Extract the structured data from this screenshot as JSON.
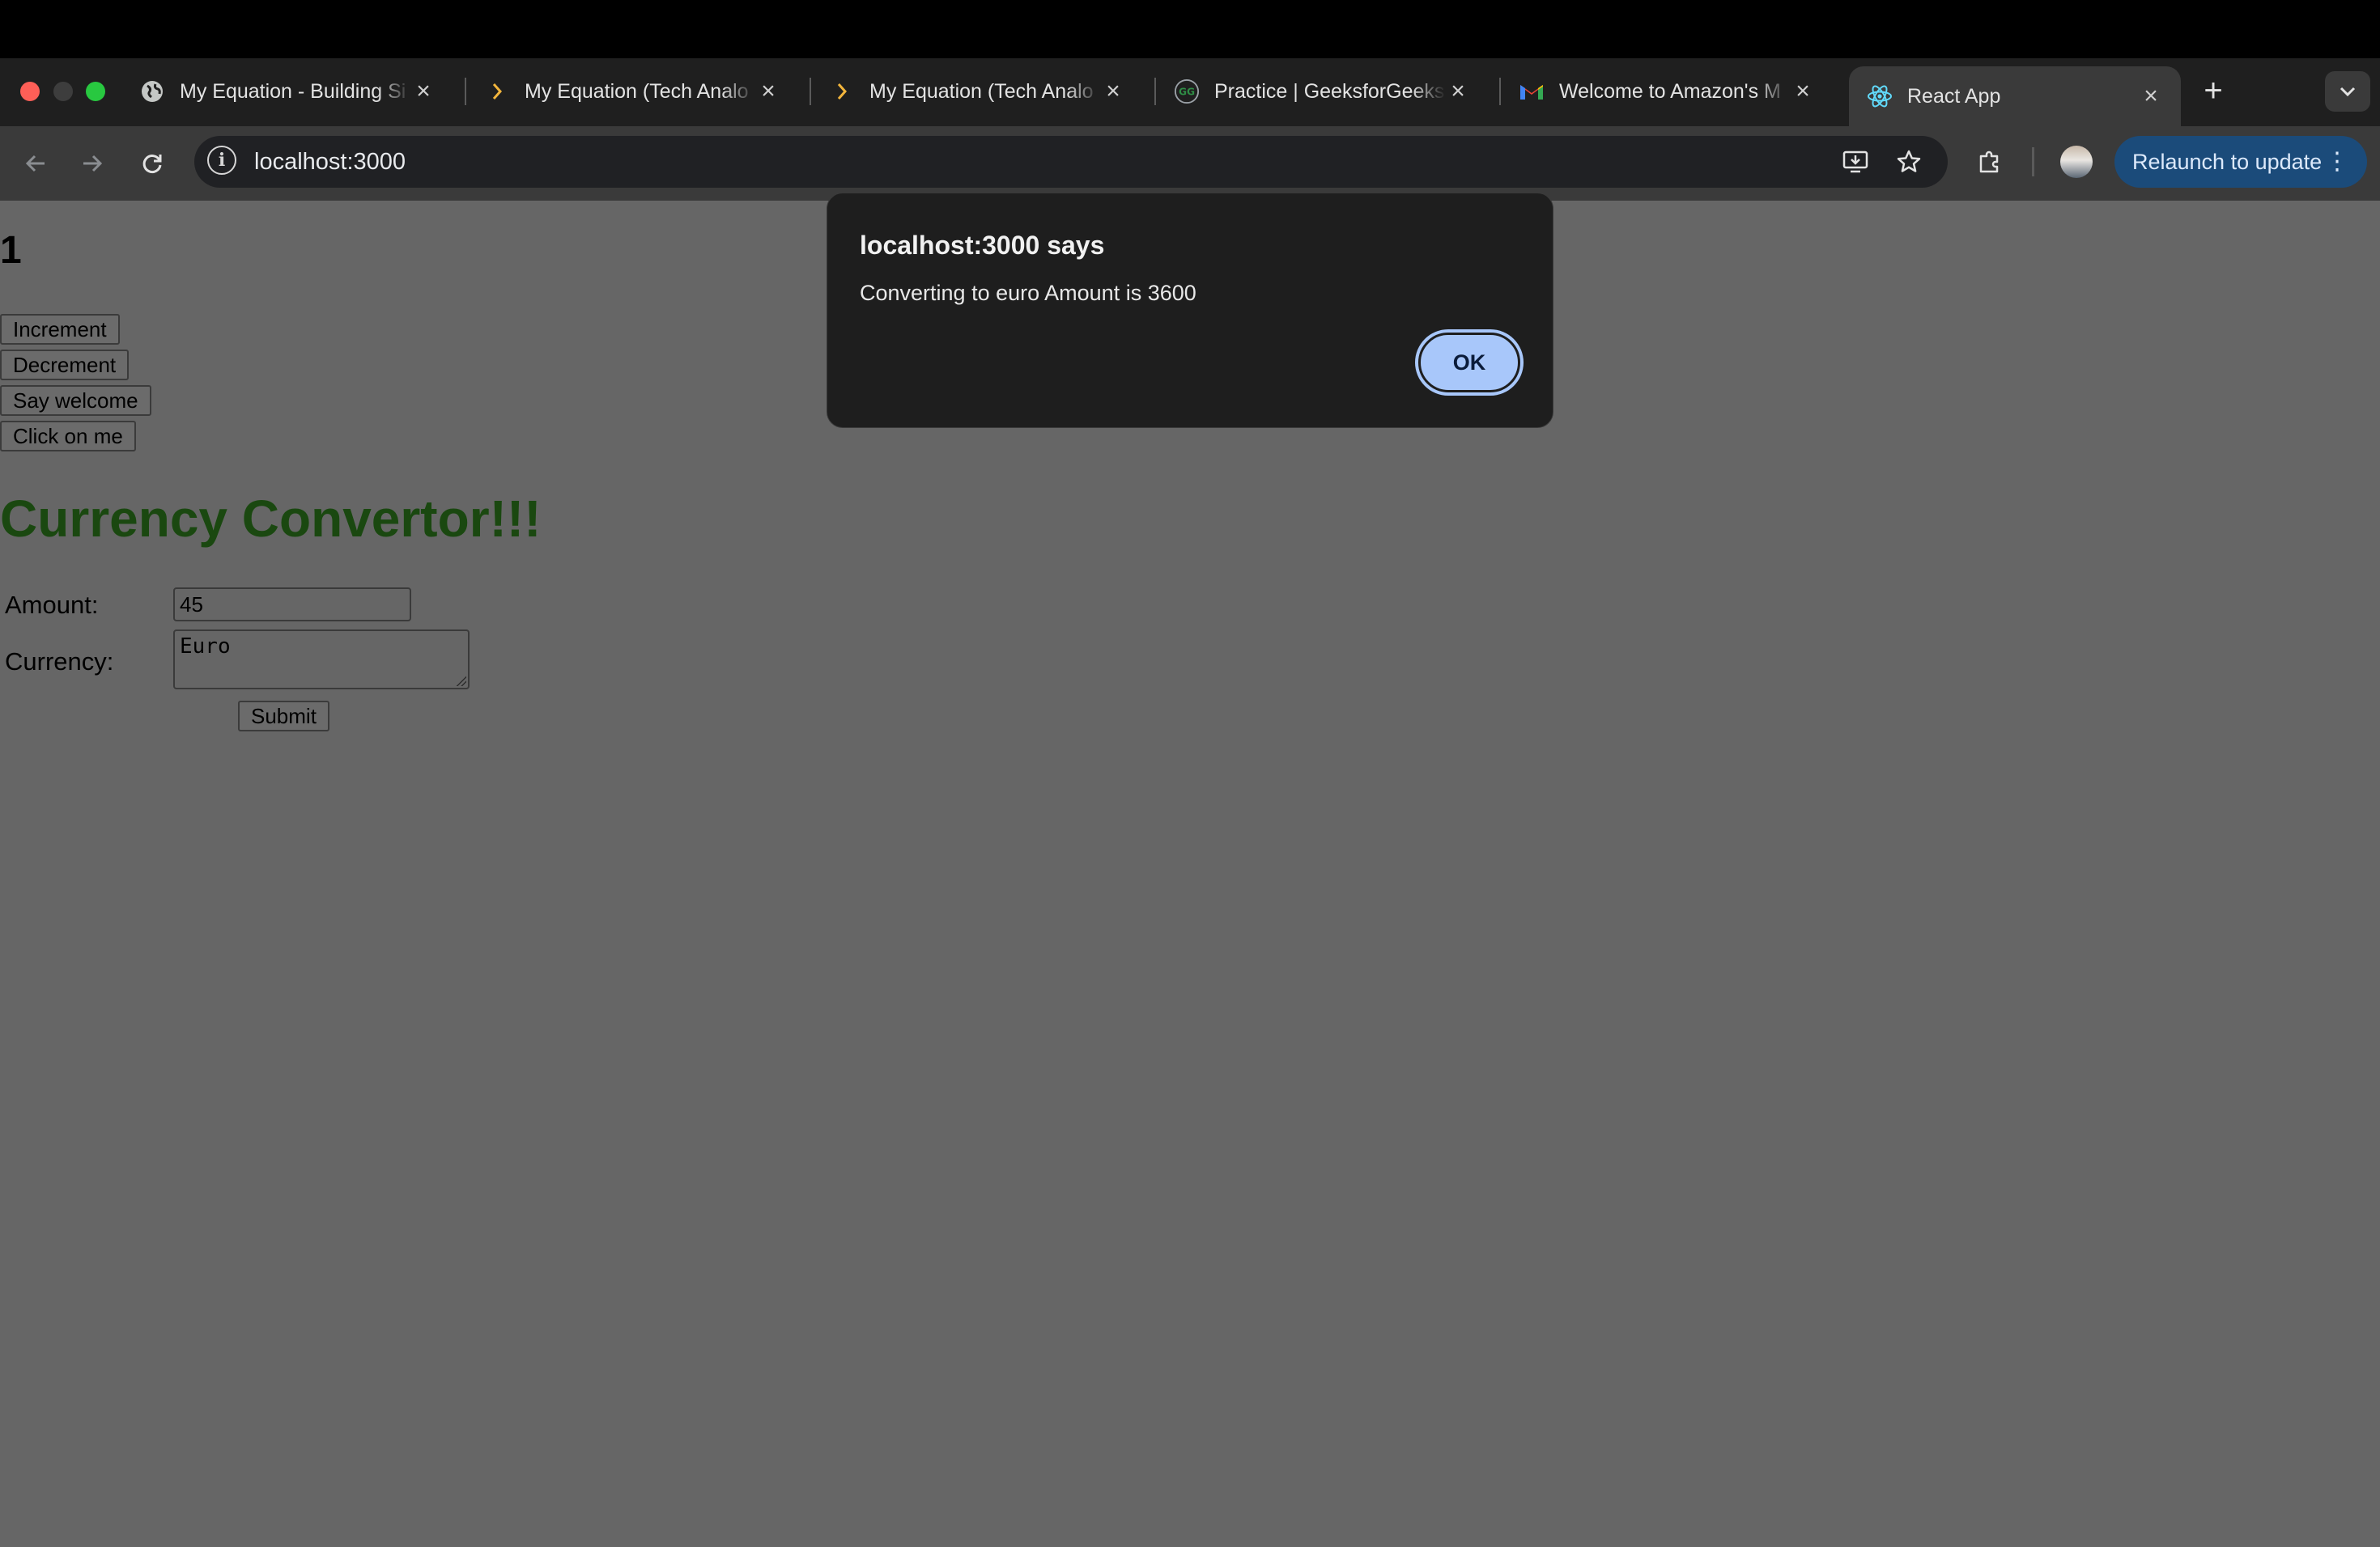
{
  "browser": {
    "tabs": [
      {
        "title": "My Equation - Building Si",
        "icon": "globe-icon"
      },
      {
        "title": "My Equation (Tech Analo",
        "icon": "chevron-right-icon"
      },
      {
        "title": "My Equation (Tech Analo",
        "icon": "chevron-right-icon"
      },
      {
        "title": "Practice | GeeksforGeeks",
        "icon": "geeksforgeeks-icon"
      },
      {
        "title": "Welcome to Amazon's M",
        "icon": "gmail-icon"
      },
      {
        "title": "React App",
        "icon": "react-icon",
        "active": true
      }
    ],
    "url": "localhost:3000",
    "relaunch_label": "Relaunch to update"
  },
  "page": {
    "count": "1",
    "buttons": {
      "increment": "Increment",
      "decrement": "Decrement",
      "say_welcome": "Say welcome",
      "click_me": "Click on me"
    },
    "heading": "Currency Convertor!!!",
    "form": {
      "amount_label": "Amount:",
      "amount_value": "45",
      "currency_label": "Currency:",
      "currency_value": "Euro",
      "submit_label": "Submit"
    }
  },
  "alert": {
    "title": "localhost:3000 says",
    "message": "Converting to euro Amount is 3600",
    "ok_label": "OK"
  },
  "colors": {
    "heading": "#1a4810",
    "ok_button": "#a8c7fa",
    "relaunch_button": "#1b4b7a"
  }
}
